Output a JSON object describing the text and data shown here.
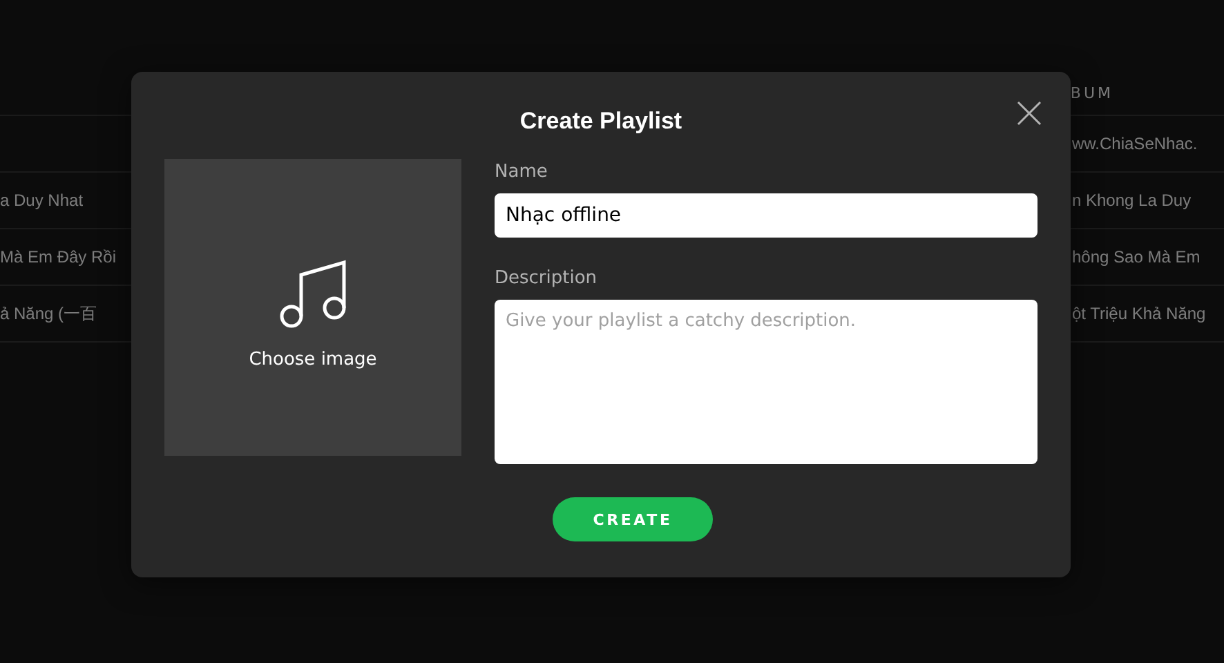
{
  "background_table": {
    "header": {
      "column_2": "BUM"
    },
    "rows": [
      {
        "column_1": "",
        "column_2": "ww.ChiaSeNhac."
      },
      {
        "column_1": "a Duy Nhat",
        "column_2": "n Khong La Duy"
      },
      {
        "column_1": "Mà Em Đây Rồi",
        "column_2": "hông Sao Mà Em"
      },
      {
        "column_1": "ả Năng (一百",
        "column_2": "ột Triệu Khả Năng"
      }
    ]
  },
  "dialog": {
    "title": "Create Playlist",
    "image": {
      "label": "Choose image"
    },
    "name": {
      "label": "Name",
      "value": "Nhạc offline"
    },
    "description": {
      "label": "Description",
      "placeholder": "Give your playlist a catchy description."
    },
    "button": "CREATE"
  }
}
